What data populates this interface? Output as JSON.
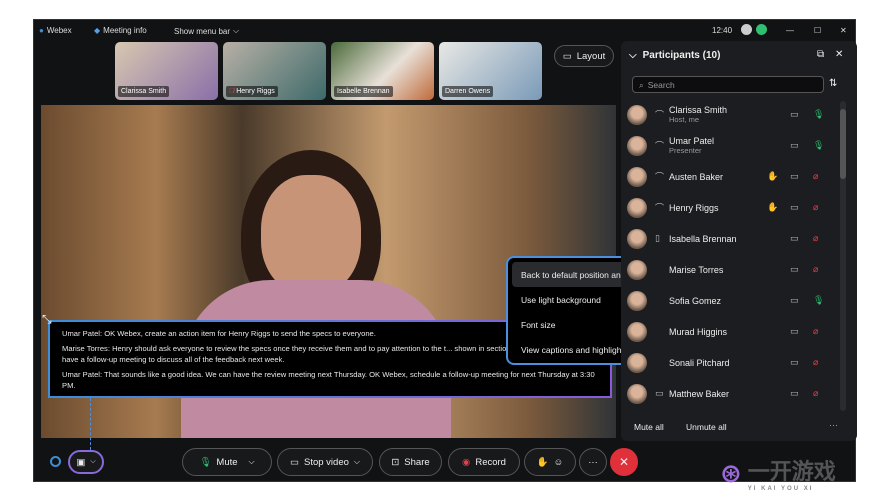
{
  "titlebar": {
    "app": "Webex",
    "meeting_info": "Meeting info",
    "show_menu_bar": "Show menu bar",
    "time": "12:40"
  },
  "thumbnails": [
    {
      "name": "Clarissa Smith",
      "muted": false
    },
    {
      "name": "Henry Riggs",
      "muted": true
    },
    {
      "name": "Isabelle Brennan",
      "muted": false
    },
    {
      "name": "Darren Owens",
      "muted": false
    }
  ],
  "layout_button": "Layout",
  "participants": {
    "title": "Participants (10)",
    "search_placeholder": "Search",
    "items": [
      {
        "name": "Clarissa Smith",
        "role": "Host, me",
        "device": "headset",
        "hand": false,
        "mic": "on"
      },
      {
        "name": "Umar Patel",
        "role": "Presenter",
        "device": "headset",
        "hand": false,
        "mic": "on"
      },
      {
        "name": "Austen Baker",
        "role": "",
        "device": "headset",
        "hand": true,
        "mic": "muted"
      },
      {
        "name": "Henry Riggs",
        "role": "",
        "device": "headset",
        "hand": true,
        "mic": "muted"
      },
      {
        "name": "Isabella Brennan",
        "role": "",
        "device": "phone",
        "hand": false,
        "mic": "muted"
      },
      {
        "name": "Marise Torres",
        "role": "",
        "device": "",
        "hand": false,
        "mic": "muted"
      },
      {
        "name": "Sofia Gomez",
        "role": "",
        "device": "",
        "hand": false,
        "mic": "on"
      },
      {
        "name": "Murad Higgins",
        "role": "",
        "device": "",
        "hand": false,
        "mic": "muted"
      },
      {
        "name": "Sonali Pitchard",
        "role": "",
        "device": "",
        "hand": false,
        "mic": "muted"
      },
      {
        "name": "Matthew Baker",
        "role": "",
        "device": "room",
        "hand": false,
        "mic": "muted"
      }
    ],
    "mute_all": "Mute all",
    "unmute_all": "Unmute all"
  },
  "captions": [
    "Umar Patel: OK Webex, create an action item for Henry Riggs to send the specs to everyone.",
    "Marise Torres: Henry should ask everyone to review the specs once they receive them and to pay attention to the t... shown in section 4.0. Then we should have a follow-up meeting to discuss all of the feedback next week.",
    "Umar Patel: That sounds like a good idea. We can have the review meeting next Thursday. OK Webex, schedule a follow-up meeting for next Thursday at 3:30 PM."
  ],
  "caption_menu": [
    "Back to default position and size",
    "Use light background",
    "Font size",
    "View captions and highlights"
  ],
  "toolbar": {
    "mute": "Mute",
    "stop_video": "Stop video",
    "share": "Share",
    "record": "Record",
    "more": "···"
  },
  "colors": {
    "accent": "#3a8fd8",
    "mic_on": "#2fbf71",
    "mic_muted": "#e0414b",
    "end_call": "#e0313b"
  },
  "watermark": {
    "text": "一开游戏",
    "sub": "YI KAI YOU XI"
  }
}
